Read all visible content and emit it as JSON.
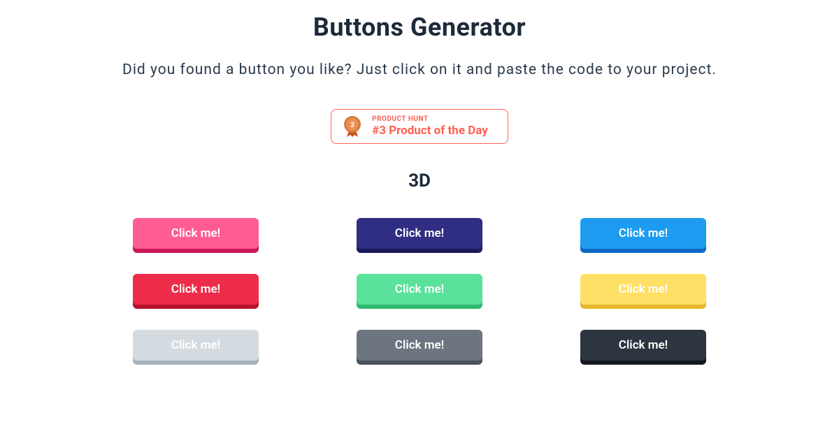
{
  "header": {
    "title": "Buttons Generator",
    "subtitle": "Did you found a button you like? Just click on it and paste the code to your project."
  },
  "product_hunt": {
    "label": "PRODUCT HUNT",
    "rank_text": "#3 Product of the Day",
    "medal_number": "3"
  },
  "section": {
    "title": "3D"
  },
  "buttons": [
    {
      "label": "Click me!",
      "bg": "#ff5c93",
      "shadow": "#c9185a"
    },
    {
      "label": "Click me!",
      "bg": "#2f2e82",
      "shadow": "#1a195a"
    },
    {
      "label": "Click me!",
      "bg": "#1d9bf0",
      "shadow": "#0d6bc3"
    },
    {
      "label": "Click me!",
      "bg": "#ed2c49",
      "shadow": "#b5132d"
    },
    {
      "label": "Click me!",
      "bg": "#5be29a",
      "shadow": "#2fb86f"
    },
    {
      "label": "Click me!",
      "bg": "#ffe066",
      "shadow": "#e4b82c"
    },
    {
      "label": "Click me!",
      "bg": "#d4dbe0",
      "shadow": "#a8b4bd"
    },
    {
      "label": "Click me!",
      "bg": "#6c7580",
      "shadow": "#4a525b"
    },
    {
      "label": "Click me!",
      "bg": "#2d3540",
      "shadow": "#14181e"
    }
  ]
}
